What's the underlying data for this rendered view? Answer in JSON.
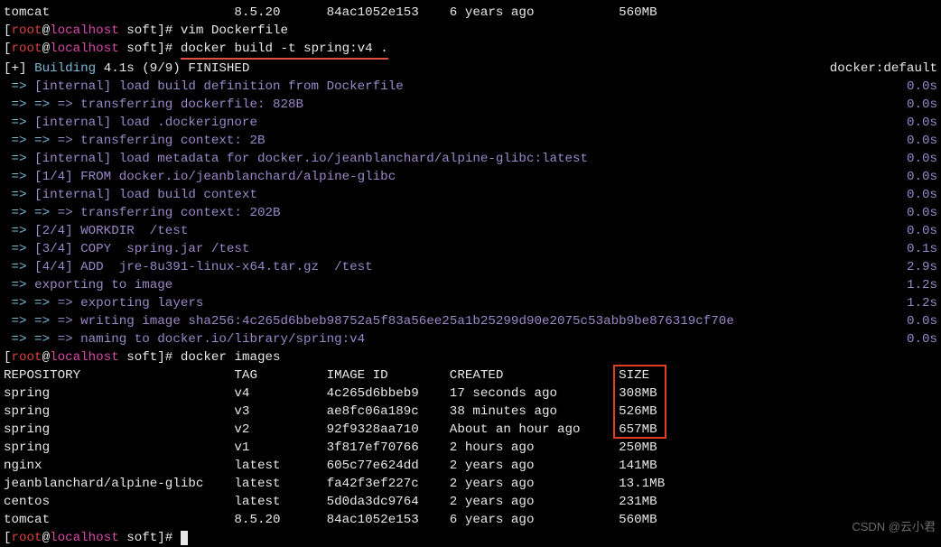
{
  "top_table_fragment": {
    "repo": "tomcat",
    "tag": "8.5.20",
    "image_id": "84ac1052e153",
    "created": "6 years ago",
    "size": "560MB"
  },
  "prompt": {
    "lbracket": "[",
    "user": "root",
    "at": "@",
    "host": "localhost",
    "path": " soft",
    "rbracket": "]# "
  },
  "cmd_vim": "vim Dockerfile",
  "cmd_build": "docker build -t spring:v4 .",
  "building_line": {
    "prefix": "[+] ",
    "text": "Building ",
    "rest": "4.1s (9/9) FINISHED",
    "right": "docker:default"
  },
  "steps": [
    {
      "l": "[internal] load build definition from Dockerfile",
      "t": "0.0s",
      "d": 0
    },
    {
      "l": "=> transferring dockerfile: 828B",
      "t": "0.0s",
      "d": 1
    },
    {
      "l": "[internal] load .dockerignore",
      "t": "0.0s",
      "d": 0
    },
    {
      "l": "=> transferring context: 2B",
      "t": "0.0s",
      "d": 1
    },
    {
      "l": "[internal] load metadata for docker.io/jeanblanchard/alpine-glibc:latest",
      "t": "0.0s",
      "d": 0
    },
    {
      "l": "[1/4] FROM docker.io/jeanblanchard/alpine-glibc",
      "t": "0.0s",
      "d": 0
    },
    {
      "l": "[internal] load build context",
      "t": "0.0s",
      "d": 0
    },
    {
      "l": "=> transferring context: 202B",
      "t": "0.0s",
      "d": 1
    },
    {
      "l": "[2/4] WORKDIR  /test",
      "t": "0.0s",
      "d": 0
    },
    {
      "l": "[3/4] COPY  spring.jar /test",
      "t": "0.1s",
      "d": 0
    },
    {
      "l": "[4/4] ADD  jre-8u391-linux-x64.tar.gz  /test",
      "t": "2.9s",
      "d": 0
    },
    {
      "l": "exporting to image",
      "t": "1.2s",
      "d": 0
    },
    {
      "l": "=> exporting layers",
      "t": "1.2s",
      "d": 1
    },
    {
      "l": "=> writing image sha256:4c265d6bbeb98752a5f83a56ee25a1b25299d90e2075c53abb9be876319cf70e",
      "t": "0.0s",
      "d": 1
    },
    {
      "l": "=> naming to docker.io/library/spring:v4",
      "t": "0.0s",
      "d": 1
    }
  ],
  "cmd_images": "docker images",
  "images_header": {
    "repo": "REPOSITORY",
    "tag": "TAG",
    "id": "IMAGE ID",
    "created": "CREATED",
    "size": "SIZE"
  },
  "images": [
    {
      "repo": "spring",
      "tag": "v4",
      "id": "4c265d6bbeb9",
      "created": "17 seconds ago",
      "size": "308MB"
    },
    {
      "repo": "spring",
      "tag": "v3",
      "id": "ae8fc06a189c",
      "created": "38 minutes ago",
      "size": "526MB"
    },
    {
      "repo": "spring",
      "tag": "v2",
      "id": "92f9328aa710",
      "created": "About an hour ago",
      "size": "657MB"
    },
    {
      "repo": "spring",
      "tag": "v1",
      "id": "3f817ef70766",
      "created": "2 hours ago",
      "size": "250MB"
    },
    {
      "repo": "nginx",
      "tag": "latest",
      "id": "605c77e624dd",
      "created": "2 years ago",
      "size": "141MB"
    },
    {
      "repo": "jeanblanchard/alpine-glibc",
      "tag": "latest",
      "id": "fa42f3ef227c",
      "created": "2 years ago",
      "size": "13.1MB"
    },
    {
      "repo": "centos",
      "tag": "latest",
      "id": "5d0da3dc9764",
      "created": "2 years ago",
      "size": "231MB"
    },
    {
      "repo": "tomcat",
      "tag": "8.5.20",
      "id": "84ac1052e153",
      "created": "6 years ago",
      "size": "560MB"
    }
  ],
  "watermark": "CSDN @云小君",
  "cols": {
    "repo": 30,
    "tag": 12,
    "id": 16,
    "created": 22
  },
  "arrow1": " => ",
  "arrow2": " => => "
}
